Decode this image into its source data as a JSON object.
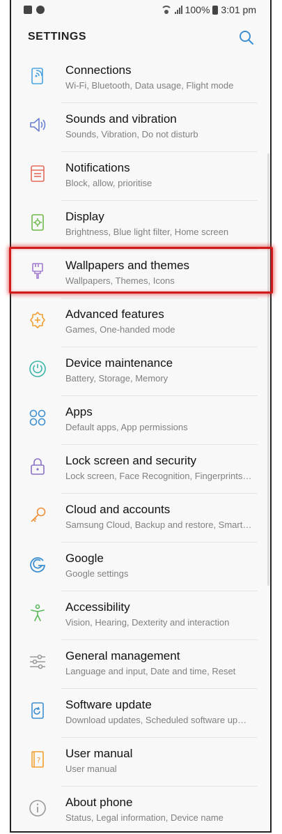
{
  "status": {
    "battery": "100%",
    "time": "3:01 pm"
  },
  "header": {
    "title": "SETTINGS"
  },
  "items": [
    {
      "title": "Connections",
      "subtitle": "Wi-Fi, Bluetooth, Data usage, Flight mode",
      "icon": "connections-icon"
    },
    {
      "title": "Sounds and vibration",
      "subtitle": "Sounds, Vibration, Do not disturb",
      "icon": "speaker-icon"
    },
    {
      "title": "Notifications",
      "subtitle": "Block, allow, prioritise",
      "icon": "notifications-icon"
    },
    {
      "title": "Display",
      "subtitle": "Brightness, Blue light filter, Home screen",
      "icon": "display-icon"
    },
    {
      "title": "Wallpapers and themes",
      "subtitle": "Wallpapers, Themes, Icons",
      "icon": "paintbrush-icon"
    },
    {
      "title": "Advanced features",
      "subtitle": "Games, One-handed mode",
      "icon": "gear-plus-icon"
    },
    {
      "title": "Device maintenance",
      "subtitle": "Battery, Storage, Memory",
      "icon": "maintenance-icon"
    },
    {
      "title": "Apps",
      "subtitle": "Default apps, App permissions",
      "icon": "apps-icon"
    },
    {
      "title": "Lock screen and security",
      "subtitle": "Lock screen, Face Recognition, Fingerprints…",
      "icon": "lock-icon"
    },
    {
      "title": "Cloud and accounts",
      "subtitle": "Samsung Cloud, Backup and restore, Smart…",
      "icon": "key-icon"
    },
    {
      "title": "Google",
      "subtitle": "Google settings",
      "icon": "google-icon"
    },
    {
      "title": "Accessibility",
      "subtitle": "Vision, Hearing, Dexterity and interaction",
      "icon": "accessibility-icon"
    },
    {
      "title": "General management",
      "subtitle": "Language and input, Date and time, Reset",
      "icon": "sliders-icon"
    },
    {
      "title": "Software update",
      "subtitle": "Download updates, Scheduled software up…",
      "icon": "software-update-icon"
    },
    {
      "title": "User manual",
      "subtitle": "User manual",
      "icon": "manual-icon"
    },
    {
      "title": "About phone",
      "subtitle": "Status, Legal information, Device name",
      "icon": "info-icon"
    }
  ],
  "colors": {
    "highlight": "#d11a1a",
    "search": "#3d8fd1"
  }
}
